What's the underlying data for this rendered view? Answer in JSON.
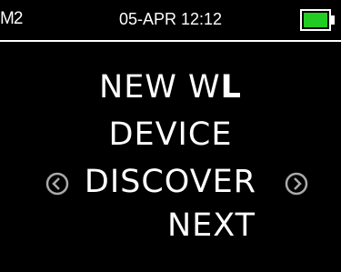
{
  "status_bar": {
    "device_id": "M2",
    "datetime": "05-APR 12:12",
    "battery_color": "#22cc22"
  },
  "menu": {
    "line1_prefix": "NEW W",
    "line1_suffix": "L",
    "line2": "DEVICE",
    "line3": "DISCOVER",
    "line4": "NEXT"
  },
  "icons": {
    "left": "chevron-left-circle-icon",
    "right": "chevron-right-circle-icon"
  }
}
